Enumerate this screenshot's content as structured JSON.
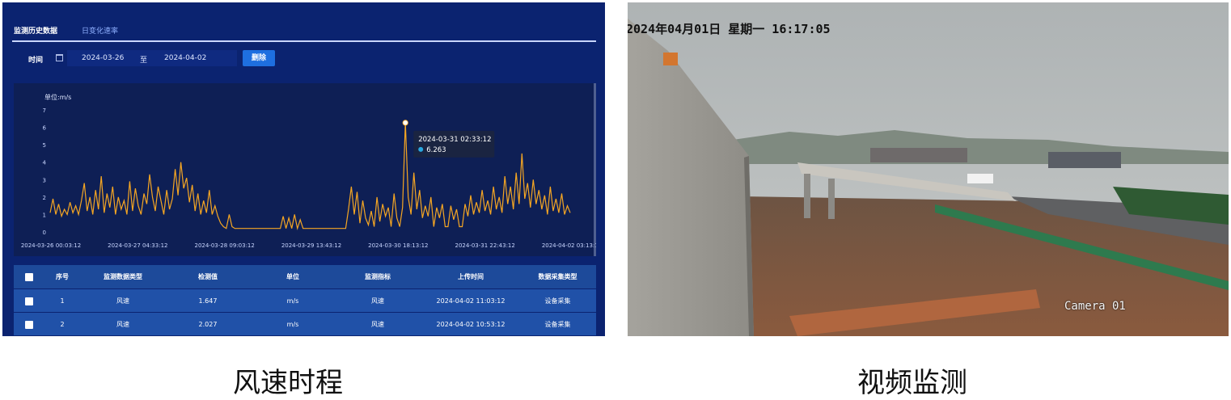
{
  "dashboard": {
    "tabs": [
      {
        "label": "监测历史数据",
        "active": true
      },
      {
        "label": "日变化速率",
        "active": false
      }
    ],
    "filter": {
      "time_label": "时间",
      "start_date": "2024-03-26",
      "range_sep": "至",
      "end_date": "2024-04-02",
      "delete_label": "删除"
    },
    "tooltip": {
      "time": "2024-03-31 02:33:12",
      "value": "6.263"
    },
    "table": {
      "headers": [
        "序号",
        "监测数据类型",
        "检测值",
        "单位",
        "监测指标",
        "上传时间",
        "数据采集类型"
      ],
      "rows": [
        [
          "1",
          "风速",
          "1.647",
          "m/s",
          "风速",
          "2024-04-02 11:03:12",
          "设备采集"
        ],
        [
          "2",
          "风速",
          "2.027",
          "m/s",
          "风速",
          "2024-04-02 10:53:12",
          "设备采集"
        ]
      ]
    }
  },
  "chart_data": {
    "type": "line",
    "ylabel": "单位:m/s",
    "ylim": [
      0,
      7
    ],
    "yticks": [
      "0",
      "1",
      "2",
      "3",
      "4",
      "5",
      "6",
      "7"
    ],
    "x_tick_labels": [
      "2024-03-26 00:03:12",
      "2024-03-27 04:33:12",
      "2024-03-28 09:03:12",
      "2024-03-29 13:43:12",
      "2024-03-30 18:13:12",
      "2024-03-31 22:43:12",
      "2024-04-02 03:13:12"
    ],
    "x_range_hours": [
      0,
      183
    ],
    "grid": false,
    "line_color": "#f5a623",
    "highlight": {
      "time": "2024-03-31 02:33:12",
      "value": 6.263
    },
    "series": [
      {
        "values": [
          [
            0,
            1.1
          ],
          [
            1,
            1.9
          ],
          [
            2,
            1.0
          ],
          [
            3,
            1.6
          ],
          [
            4,
            0.9
          ],
          [
            5,
            1.3
          ],
          [
            6,
            1.0
          ],
          [
            7,
            1.7
          ],
          [
            8,
            1.1
          ],
          [
            9,
            1.5
          ],
          [
            10,
            1.0
          ],
          [
            11,
            1.8
          ],
          [
            12,
            2.8
          ],
          [
            13,
            1.2
          ],
          [
            14,
            2.0
          ],
          [
            15,
            1.0
          ],
          [
            16,
            2.4
          ],
          [
            17,
            1.3
          ],
          [
            18,
            3.2
          ],
          [
            19,
            1.1
          ],
          [
            20,
            2.2
          ],
          [
            21,
            1.4
          ],
          [
            22,
            2.6
          ],
          [
            23,
            1.0
          ],
          [
            24,
            2.0
          ],
          [
            25,
            1.3
          ],
          [
            26,
            1.8
          ],
          [
            27,
            1.0
          ],
          [
            28,
            2.9
          ],
          [
            29,
            1.2
          ],
          [
            30,
            2.5
          ],
          [
            31,
            1.5
          ],
          [
            32,
            1.0
          ],
          [
            33,
            2.2
          ],
          [
            34,
            1.6
          ],
          [
            35,
            3.3
          ],
          [
            36,
            2.0
          ],
          [
            37,
            1.2
          ],
          [
            38,
            2.6
          ],
          [
            39,
            1.8
          ],
          [
            40,
            1.0
          ],
          [
            41,
            2.4
          ],
          [
            42,
            1.3
          ],
          [
            43,
            1.9
          ],
          [
            44,
            3.6
          ],
          [
            45,
            2.1
          ],
          [
            46,
            4.0
          ],
          [
            47,
            2.5
          ],
          [
            48,
            3.1
          ],
          [
            49,
            1.7
          ],
          [
            50,
            2.7
          ],
          [
            51,
            1.2
          ],
          [
            52,
            2.2
          ],
          [
            53,
            1.0
          ],
          [
            54,
            1.8
          ],
          [
            55,
            1.1
          ],
          [
            56,
            2.4
          ],
          [
            57,
            1.0
          ],
          [
            58,
            1.5
          ],
          [
            59,
            0.9
          ],
          [
            60,
            0.5
          ],
          [
            61,
            0.3
          ],
          [
            62,
            0.2
          ],
          [
            63,
            1.0
          ],
          [
            64,
            0.3
          ],
          [
            65,
            0.2
          ],
          [
            66,
            0.2
          ],
          [
            67,
            0.2
          ],
          [
            68,
            0.2
          ],
          [
            69,
            0.2
          ],
          [
            70,
            0.2
          ],
          [
            71,
            0.2
          ],
          [
            72,
            0.2
          ],
          [
            73,
            0.2
          ],
          [
            74,
            0.2
          ],
          [
            75,
            0.2
          ],
          [
            76,
            0.2
          ],
          [
            77,
            0.2
          ],
          [
            78,
            0.2
          ],
          [
            79,
            0.2
          ],
          [
            80,
            0.2
          ],
          [
            81,
            0.2
          ],
          [
            82,
            0.9
          ],
          [
            83,
            0.2
          ],
          [
            84,
            0.8
          ],
          [
            85,
            0.2
          ],
          [
            86,
            1.0
          ],
          [
            87,
            0.2
          ],
          [
            88,
            0.7
          ],
          [
            89,
            0.2
          ],
          [
            90,
            0.2
          ],
          [
            91,
            0.2
          ],
          [
            92,
            0.2
          ],
          [
            93,
            0.2
          ],
          [
            94,
            0.2
          ],
          [
            95,
            0.2
          ],
          [
            96,
            0.2
          ],
          [
            97,
            0.2
          ],
          [
            98,
            0.2
          ],
          [
            99,
            0.2
          ],
          [
            100,
            0.2
          ],
          [
            101,
            0.2
          ],
          [
            102,
            0.2
          ],
          [
            103,
            0.2
          ],
          [
            104,
            0.2
          ],
          [
            105,
            1.3
          ],
          [
            106,
            2.6
          ],
          [
            107,
            1.0
          ],
          [
            108,
            2.3
          ],
          [
            109,
            0.5
          ],
          [
            110,
            1.8
          ],
          [
            111,
            0.8
          ],
          [
            112,
            0.4
          ],
          [
            113,
            1.2
          ],
          [
            114,
            0.3
          ],
          [
            115,
            2.0
          ],
          [
            116,
            0.6
          ],
          [
            117,
            1.6
          ],
          [
            118,
            0.9
          ],
          [
            119,
            1.4
          ],
          [
            120,
            0.3
          ],
          [
            121,
            2.2
          ],
          [
            122,
            0.8
          ],
          [
            123,
            0.3
          ],
          [
            124,
            1.4
          ],
          [
            125,
            6.263
          ],
          [
            126,
            2.0
          ],
          [
            127,
            1.0
          ],
          [
            128,
            3.4
          ],
          [
            129,
            1.3
          ],
          [
            130,
            2.4
          ],
          [
            131,
            0.8
          ],
          [
            132,
            1.5
          ],
          [
            133,
            0.9
          ],
          [
            134,
            2.0
          ],
          [
            135,
            0.3
          ],
          [
            136,
            1.4
          ],
          [
            137,
            0.8
          ],
          [
            138,
            1.6
          ],
          [
            139,
            0.3
          ],
          [
            140,
            0.3
          ],
          [
            141,
            1.5
          ],
          [
            142,
            0.7
          ],
          [
            143,
            1.3
          ],
          [
            144,
            0.3
          ],
          [
            145,
            0.3
          ],
          [
            146,
            1.6
          ],
          [
            147,
            0.9
          ],
          [
            148,
            2.1
          ],
          [
            149,
            1.0
          ],
          [
            150,
            1.7
          ],
          [
            151,
            1.1
          ],
          [
            152,
            2.4
          ],
          [
            153,
            1.2
          ],
          [
            154,
            1.8
          ],
          [
            155,
            1.0
          ],
          [
            156,
            2.6
          ],
          [
            157,
            1.3
          ],
          [
            158,
            2.0
          ],
          [
            159,
            1.1
          ],
          [
            160,
            3.2
          ],
          [
            161,
            1.6
          ],
          [
            162,
            2.6
          ],
          [
            163,
            1.3
          ],
          [
            164,
            3.4
          ],
          [
            165,
            1.6
          ],
          [
            166,
            4.5
          ],
          [
            167,
            1.9
          ],
          [
            168,
            2.8
          ],
          [
            169,
            1.4
          ],
          [
            170,
            3.0
          ],
          [
            171,
            1.6
          ],
          [
            172,
            2.4
          ],
          [
            173,
            1.3
          ],
          [
            174,
            2.1
          ],
          [
            175,
            1.0
          ],
          [
            176,
            2.6
          ],
          [
            177,
            1.2
          ],
          [
            178,
            1.9
          ],
          [
            179,
            1.1
          ],
          [
            180,
            2.2
          ],
          [
            181,
            1.0
          ],
          [
            182,
            1.5
          ],
          [
            183,
            1.1
          ]
        ]
      }
    ]
  },
  "camera": {
    "datetime_text": "2024年04月01日 星期一 16:17:05",
    "camera_label": "Camera 01"
  },
  "captions": {
    "left": "风速时程",
    "right": "视频监测"
  }
}
